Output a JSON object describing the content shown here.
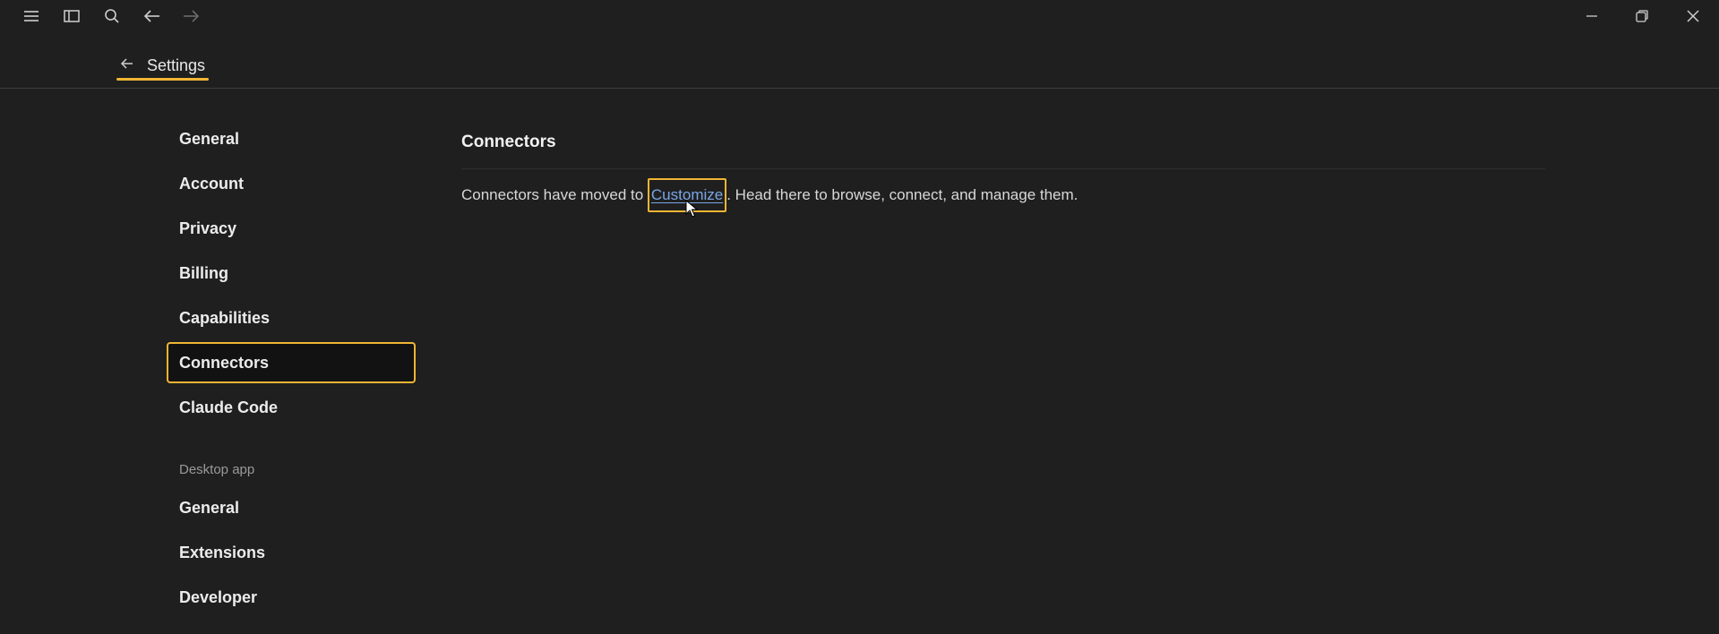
{
  "titlebar": {
    "icons": [
      "menu-icon",
      "sidebar-icon",
      "search-icon",
      "back-arrow-icon",
      "forward-arrow-icon"
    ],
    "window_controls": [
      "minimize-icon",
      "restore-icon",
      "close-icon"
    ]
  },
  "header": {
    "back_icon": "arrow-left-icon",
    "title": "Settings"
  },
  "nav": {
    "items": [
      {
        "label": "General"
      },
      {
        "label": "Account"
      },
      {
        "label": "Privacy"
      },
      {
        "label": "Billing"
      },
      {
        "label": "Capabilities"
      },
      {
        "label": "Connectors",
        "active": true
      },
      {
        "label": "Claude Code"
      }
    ],
    "desktop_section_label": "Desktop app",
    "desktop_items": [
      {
        "label": "General"
      },
      {
        "label": "Extensions"
      },
      {
        "label": "Developer"
      }
    ]
  },
  "main": {
    "title": "Connectors",
    "text_before": "Connectors have moved to ",
    "link_label": "Customize",
    "text_after": ". Head there to browse, connect, and manage them."
  },
  "colors": {
    "background": "#1f1f1f",
    "accent_highlight": "#f0b535",
    "link": "#7aa7e8"
  }
}
